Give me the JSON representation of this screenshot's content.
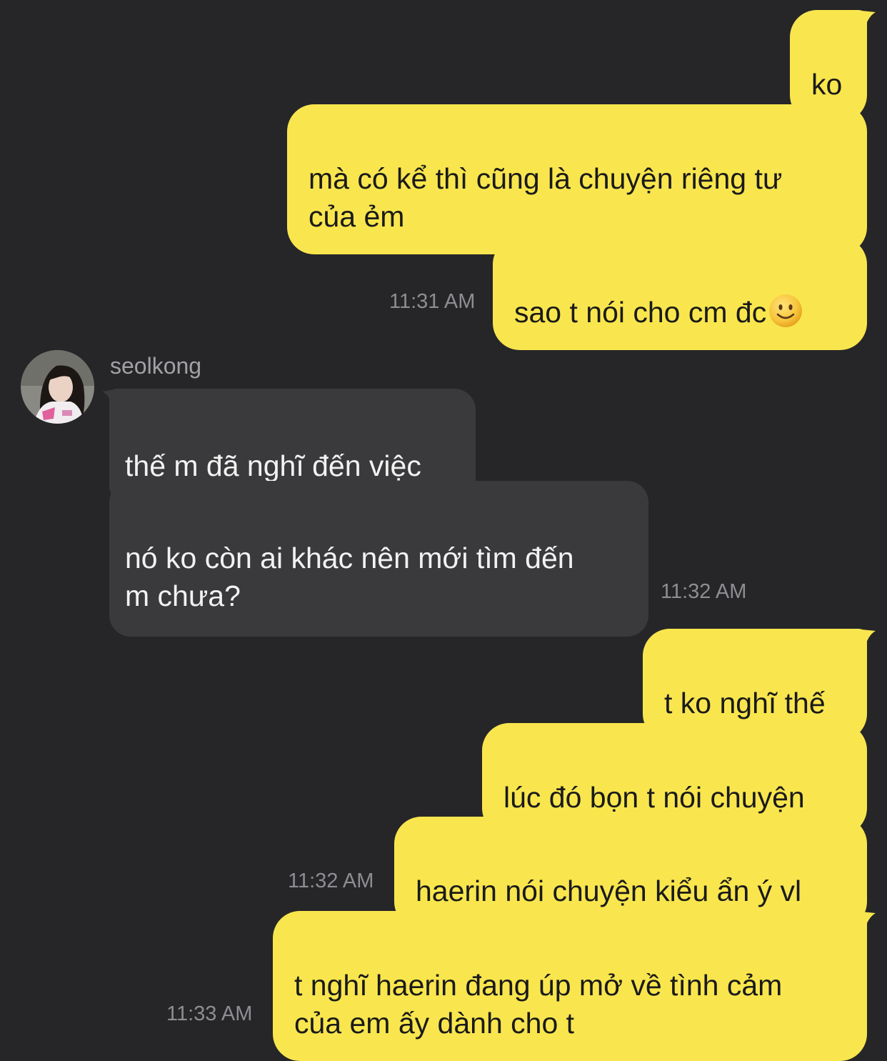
{
  "conversation": {
    "messages": [
      {
        "text": "ko"
      },
      {
        "text": "mà có kể thì cũng là chuyện riêng tư\ncủa ẻm"
      },
      {
        "text": "sao t nói cho cm đc",
        "emoji": "slightly-smiling-face-emoji"
      },
      {
        "text": "thế m đã nghĩ đến việc"
      },
      {
        "text": "nó ko còn ai khác nên mới tìm đến\nm chưa?"
      },
      {
        "text": "t ko nghĩ thế"
      },
      {
        "text": "lúc đó bọn t nói chuyện"
      },
      {
        "text": "haerin nói chuyện kiểu ẩn ý vl"
      },
      {
        "text": "t nghĩ haerin đang úp mở về tình cảm\ncủa em ấy dành cho t"
      }
    ],
    "timestamps": [
      "11:31 AM",
      "11:32 AM",
      "11:32 AM",
      "11:33 AM"
    ],
    "contact": {
      "name": "seolkong",
      "avatar_icon": "profile-photo-avatar"
    }
  },
  "colors": {
    "background": "#262628",
    "outgoing_bubble": "#f9e64e",
    "incoming_bubble": "#3a3a3c",
    "timestamp": "#8d8d92"
  }
}
